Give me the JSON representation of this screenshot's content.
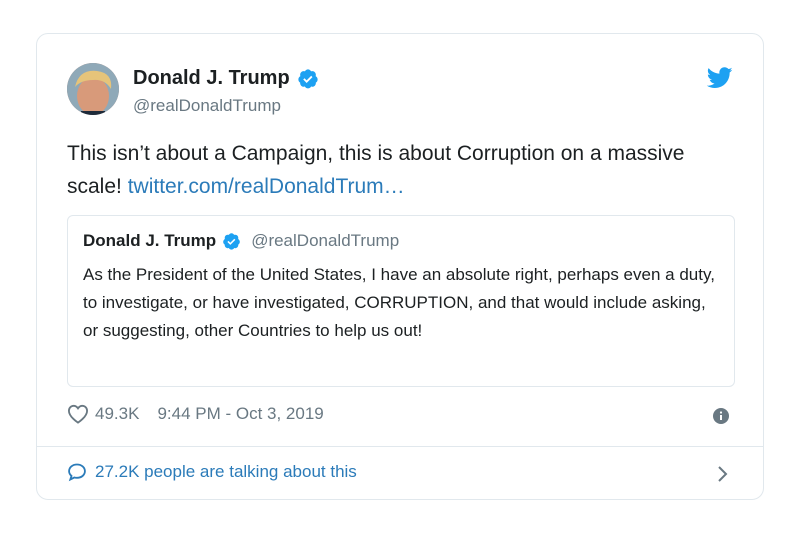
{
  "tweet": {
    "author": {
      "name": "Donald J. Trump",
      "handle": "@realDonaldTrump",
      "verified": true
    },
    "text": "This isn’t about a Campaign, this is about Corruption on a massive scale! ",
    "link_text": "twitter.com/realDonaldTrum…",
    "quoted": {
      "name": "Donald J. Trump",
      "handle": "@realDonaldTrump",
      "text": "As the President of the United States, I have an absolute right, perhaps even a duty, to investigate, or have investigated, CORRUPTION, and that would include asking, or suggesting, other Countries to help us out!"
    },
    "likes": "49.3K",
    "timestamp": "9:44 PM - Oct 3, 2019",
    "talking": "27.2K people are talking about this"
  },
  "icons": {
    "brand": "twitter-bird-icon",
    "verified": "verified-badge-icon",
    "like": "heart-icon",
    "info": "info-icon",
    "reply": "speech-bubble-icon",
    "more": "chevron-right-icon"
  },
  "colors": {
    "link": "#2b7bb9",
    "verified": "#1da1f2",
    "secondary_text": "#697882",
    "border": "#e1e8ed"
  }
}
